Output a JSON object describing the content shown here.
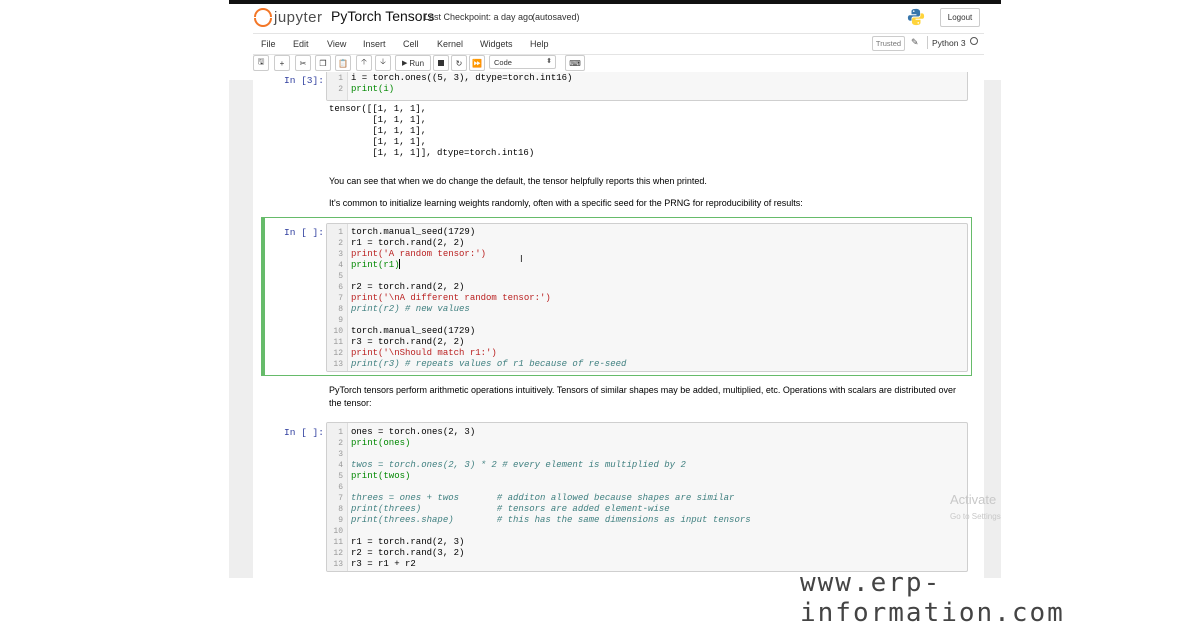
{
  "header": {
    "logo_text": "jupyter",
    "notebook_title": "PyTorch Tensors",
    "checkpoint": "Last Checkpoint: a day ago",
    "autosave": "(autosaved)",
    "logout_label": "Logout"
  },
  "menu": [
    "File",
    "Edit",
    "View",
    "Insert",
    "Cell",
    "Kernel",
    "Widgets",
    "Help"
  ],
  "kernel": {
    "trusted_label": "Trusted",
    "name": "Python 3"
  },
  "toolbar": {
    "run_label": "Run",
    "cell_type": "Code"
  },
  "cells": {
    "c1": {
      "prompt": "In [3]:",
      "lines": [
        {
          "n": "1",
          "text": "i = torch.ones((5, 3), dtype=torch.int16)"
        },
        {
          "n": "2",
          "text": "print(i)"
        }
      ],
      "output": [
        "tensor([[1, 1, 1],",
        "        [1, 1, 1],",
        "        [1, 1, 1],",
        "        [1, 1, 1],",
        "        [1, 1, 1]], dtype=torch.int16)"
      ]
    },
    "md1": "You can see that when we do change the default, the tensor helpfully reports this when printed.",
    "md2": "It's common to initialize learning weights randomly, often with a specific seed for the PRNG for reproducibility of results:",
    "c2": {
      "prompt": "In [ ]:",
      "lines": [
        {
          "n": "1",
          "text": "torch.manual_seed(1729)"
        },
        {
          "n": "2",
          "text": "r1 = torch.rand(2, 2)"
        },
        {
          "n": "3",
          "text": "print('A random tensor:')"
        },
        {
          "n": "4",
          "text": "print(r1)"
        },
        {
          "n": "5",
          "text": ""
        },
        {
          "n": "6",
          "text": "r2 = torch.rand(2, 2)"
        },
        {
          "n": "7",
          "text": "print('\\nA different random tensor:')"
        },
        {
          "n": "8",
          "text": "print(r2) # new values"
        },
        {
          "n": "9",
          "text": ""
        },
        {
          "n": "10",
          "text": "torch.manual_seed(1729)"
        },
        {
          "n": "11",
          "text": "r3 = torch.rand(2, 2)"
        },
        {
          "n": "12",
          "text": "print('\\nShould match r1:')"
        },
        {
          "n": "13",
          "text": "print(r3) # repeats values of r1 because of re-seed"
        }
      ]
    },
    "md3a": "PyTorch tensors perform arithmetic operations intuitively. Tensors of similar shapes may be added, multiplied, etc. Operations with scalars are distributed over",
    "md3b": "the tensor:",
    "c3": {
      "prompt": "In [ ]:",
      "lines": [
        {
          "n": "1",
          "text": "ones = torch.ones(2, 3)"
        },
        {
          "n": "2",
          "text": "print(ones)"
        },
        {
          "n": "3",
          "text": ""
        },
        {
          "n": "4",
          "text": "twos = torch.ones(2, 3) * 2 # every element is multiplied by 2"
        },
        {
          "n": "5",
          "text": "print(twos)"
        },
        {
          "n": "6",
          "text": ""
        },
        {
          "n": "7",
          "text": "threes = ones + twos       # additon allowed because shapes are similar"
        },
        {
          "n": "8",
          "text": "print(threes)              # tensors are added element-wise"
        },
        {
          "n": "9",
          "text": "print(threes.shape)        # this has the same dimensions as input tensors"
        },
        {
          "n": "10",
          "text": ""
        },
        {
          "n": "11",
          "text": "r1 = torch.rand(2, 3)"
        },
        {
          "n": "12",
          "text": "r2 = torch.rand(3, 2)"
        },
        {
          "n": "13",
          "text": "r3 = r1 + r2"
        }
      ]
    }
  },
  "overlay": {
    "activate": "Activate",
    "activate_sub": "Go to Settings",
    "watermark": "www.erp-information.com"
  },
  "colors": {
    "accent": "#66bb6a",
    "prompt": "#303f9f",
    "jupyter_orange": "#f37626"
  }
}
